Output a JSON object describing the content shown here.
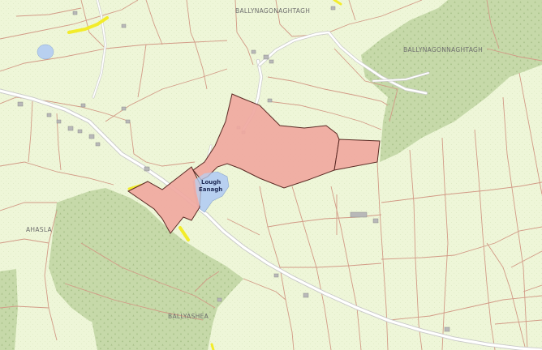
{
  "map": {
    "townlands": {
      "top": "BALLYNAGONAGHTAGH",
      "right": "BALLYNAGONNAGHTAGH",
      "left": "AHASLA",
      "bottom": "BALLYASHEA"
    },
    "lake": {
      "line1": "Lough",
      "line2": "Eanagh"
    },
    "colors": {
      "background": "#eef6d8",
      "forest": "#c6d9a9",
      "property": "#f0a8a0",
      "property_outline": "#5a2a24",
      "water": "#b8d0f0",
      "field_boundary": "#d29a86",
      "highlight": "#f2ec2a"
    }
  }
}
